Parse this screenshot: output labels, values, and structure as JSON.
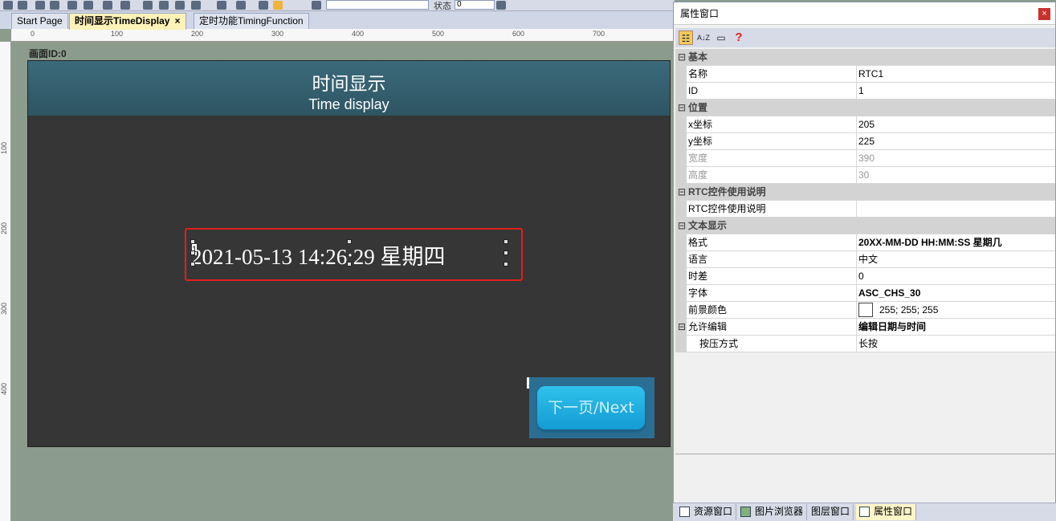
{
  "toolbar": {
    "state_label": "状态",
    "state_value": "0"
  },
  "tabs": [
    {
      "label": "Start Page"
    },
    {
      "label": "时间显示TimeDisplay",
      "close": "×"
    },
    {
      "label": "定时功能TimingFunction"
    }
  ],
  "ruler": {
    "h_ticks": [
      "0",
      "100",
      "200",
      "300",
      "400",
      "500",
      "600",
      "700"
    ],
    "v_ticks": [
      "100",
      "200",
      "300",
      "400"
    ]
  },
  "canvas": {
    "screen_label": "画面ID:0",
    "title_cn": "时间显示",
    "title_en": "Time display",
    "rtc_id": "1",
    "rtc_text": "2021-05-13 14:26:29 星期四",
    "next_id": "2",
    "next_label": "下一页/Next"
  },
  "properties": {
    "title": "属性窗口",
    "close": "×",
    "tools": {
      "categorized": "categorized-icon",
      "sort": "A↓Z",
      "pages": "property-pages-icon",
      "help": "?"
    },
    "rows": [
      {
        "type": "cat",
        "key": "基本"
      },
      {
        "key": "名称",
        "value": "RTC1"
      },
      {
        "key": "ID",
        "value": "1"
      },
      {
        "type": "cat",
        "key": "位置"
      },
      {
        "key": "x坐标",
        "value": "205"
      },
      {
        "key": "y坐标",
        "value": "225"
      },
      {
        "key": "宽度",
        "value": "390",
        "ro": true
      },
      {
        "key": "高度",
        "value": "30",
        "ro": true
      },
      {
        "type": "cat",
        "key": "RTC控件使用说明"
      },
      {
        "key": "RTC控件使用说明",
        "value": ""
      },
      {
        "type": "cat",
        "key": "文本显示"
      },
      {
        "key": "格式",
        "value": "20XX-MM-DD HH:MM:SS 星期几",
        "bold": true
      },
      {
        "key": "语言",
        "value": "中文"
      },
      {
        "key": "时差",
        "value": "0"
      },
      {
        "key": "字体",
        "value": "ASC_CHS_30",
        "bold": true
      },
      {
        "key": "前景颜色",
        "value": "255; 255; 255",
        "swatch": true
      },
      {
        "type": "cat2",
        "key": "允许编辑",
        "value": "编辑日期与时间",
        "bold": true
      },
      {
        "type": "child",
        "key": "按压方式",
        "value": "长按"
      }
    ]
  },
  "bottom_tabs": [
    {
      "label": "资源窗口",
      "icon": "resource-icon"
    },
    {
      "label": "图片浏览器",
      "icon": "image-icon"
    },
    {
      "label": "图层窗口",
      "icon": "layer-icon"
    },
    {
      "label": "属性窗口",
      "icon": "grid-icon",
      "active": true
    }
  ],
  "colors": {
    "selection": "#e0201c",
    "header": "#3b6a7a",
    "button": "#1ea9de",
    "foreground": "#ffffff"
  }
}
